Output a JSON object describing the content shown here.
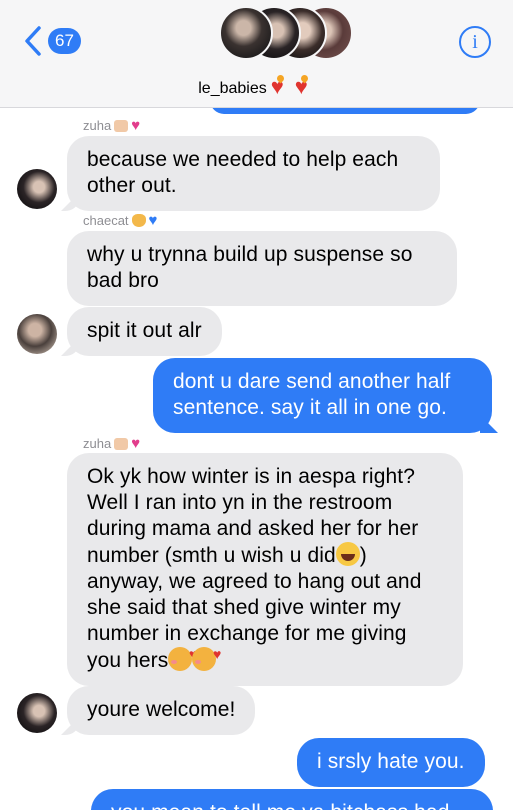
{
  "header": {
    "back_count": "67",
    "group_name": "le_babies",
    "info_label": "i"
  },
  "messages": [
    {
      "sender": "zuha",
      "text": "because we needed to help each other out.",
      "direction": "incoming"
    },
    {
      "sender": "chaecat",
      "text": "why u trynna build up suspense so bad bro",
      "direction": "incoming"
    },
    {
      "text": "spit it out alr",
      "direction": "incoming"
    },
    {
      "text": "dont u dare send another half sentence. say it all in one go.",
      "direction": "outgoing"
    },
    {
      "sender": "zuha",
      "text_parts": [
        "Ok yk how winter is in aespa right? Well I ran into yn in the restroom during mama and asked her for her number (smth u wish u did",
        ") anyway, we agreed to hang out and she said that shed give winter my number in exchange for me giving you hers"
      ],
      "direction": "incoming"
    },
    {
      "text": "youre welcome!",
      "direction": "incoming"
    },
    {
      "text": "i srsly hate you.",
      "direction": "outgoing"
    },
    {
      "text": "you mean to tell me ya bitchass had",
      "direction": "outgoing"
    }
  ],
  "colors": {
    "accent": "#2f7cf6",
    "incoming_bubble": "#e9e9eb",
    "header_bg": "#f6f6f7"
  },
  "icons": [
    "chevron-left-icon",
    "info-icon",
    "heart-on-fire-emoji",
    "hands-emoji",
    "pink-heart-emoji",
    "blue-heart-emoji",
    "cat-emoji",
    "laughing-emoji",
    "smiling-hearts-emoji"
  ]
}
